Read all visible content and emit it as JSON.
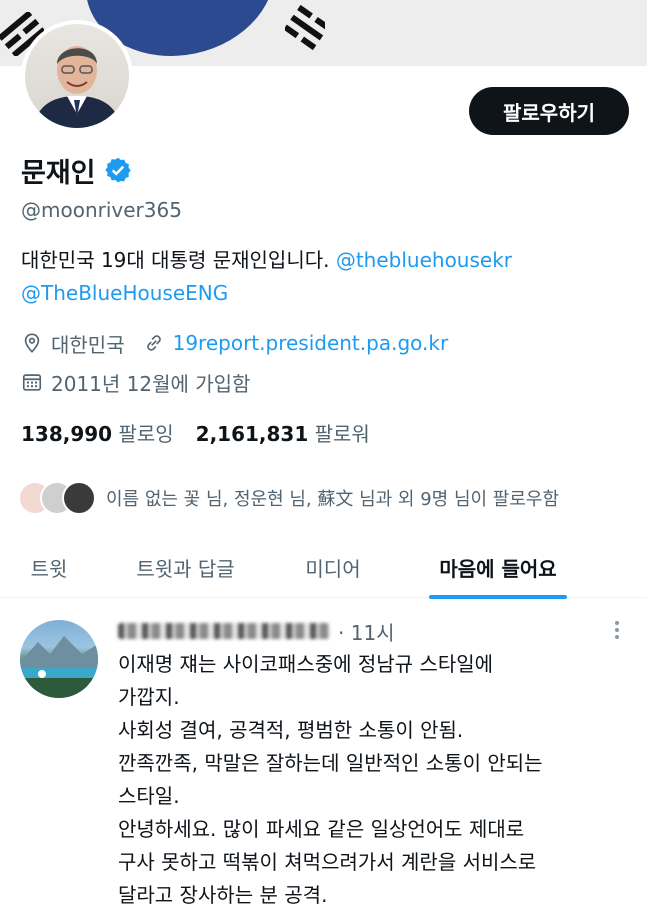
{
  "profile": {
    "name": "문재인",
    "handle": "@moonriver365",
    "follow_label": "팔로우하기",
    "bio_text": "대한민국 19대 대통령 문재인입니다. ",
    "bio_mention1": "@thebluehousekr",
    "bio_mention2": "@TheBlueHouseENG",
    "location": "대한민국",
    "website": "19report.president.pa.go.kr",
    "joined": "2011년 12월에 가입함",
    "following_count": "138,990",
    "following_label": "팔로잉",
    "followers_count": "2,161,831",
    "followers_label": "팔로워",
    "known_followers": "이름 없는 꽃 님, 정운현 님, 蘇文 님과 외 9명 님이 팔로우함"
  },
  "icons": {
    "verified": "verified-badge-icon",
    "location": "location-pin-icon",
    "link": "link-icon",
    "calendar": "calendar-icon",
    "more": "more-icon"
  },
  "colors": {
    "accent": "#1d9bf0",
    "text": "#0f1419",
    "secondary": "#536471",
    "button_bg": "#0f1419"
  },
  "tabs": [
    {
      "label": "트윗"
    },
    {
      "label": "트윗과 답글"
    },
    {
      "label": "미디어"
    },
    {
      "label": "마음에 들어요",
      "active": true
    }
  ],
  "tweet": {
    "time": "· 11시",
    "lines": [
      "이재명 쟤는 사이코패스중에 정남규 스타일에",
      "가깝지.",
      "사회성 결여, 공격적, 평범한 소통이 안됨.",
      "깐족깐족, 막말은 잘하는데 일반적인 소통이 안되는",
      "스타일.",
      "안녕하세요. 많이 파세요 같은 일상언어도 제대로",
      "구사 못하고 떡볶이 쳐먹으려가서 계란을 서비스로",
      "달라고 장사하는 분 공격."
    ]
  }
}
